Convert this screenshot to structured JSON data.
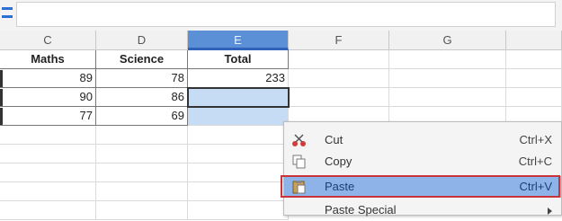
{
  "columns": [
    {
      "id": "C",
      "label": "C"
    },
    {
      "id": "D",
      "label": "D"
    },
    {
      "id": "E",
      "label": "E"
    },
    {
      "id": "F",
      "label": "F"
    },
    {
      "id": "G",
      "label": "G"
    }
  ],
  "table": {
    "headers": [
      "Maths",
      "Science",
      "Total"
    ],
    "rows": [
      [
        "89",
        "78",
        "233"
      ],
      [
        "90",
        "86",
        ""
      ],
      [
        "77",
        "69",
        ""
      ]
    ]
  },
  "context_menu": {
    "items": [
      {
        "label": "Cut",
        "shortcut": "Ctrl+X",
        "icon": "scissors-icon"
      },
      {
        "label": "Copy",
        "shortcut": "Ctrl+C",
        "icon": "copy-icon"
      },
      {
        "label": "Paste",
        "shortcut": "Ctrl+V",
        "icon": "clipboard-icon"
      },
      {
        "label": "Paste Special",
        "shortcut": "",
        "icon": "submenu-arrow-icon"
      }
    ]
  },
  "colors": {
    "selected_header": "#5b8fd6",
    "selection_fill": "#c6dcf5",
    "menu_highlight": "#8db3e8",
    "annotation_border": "#c8343a"
  }
}
